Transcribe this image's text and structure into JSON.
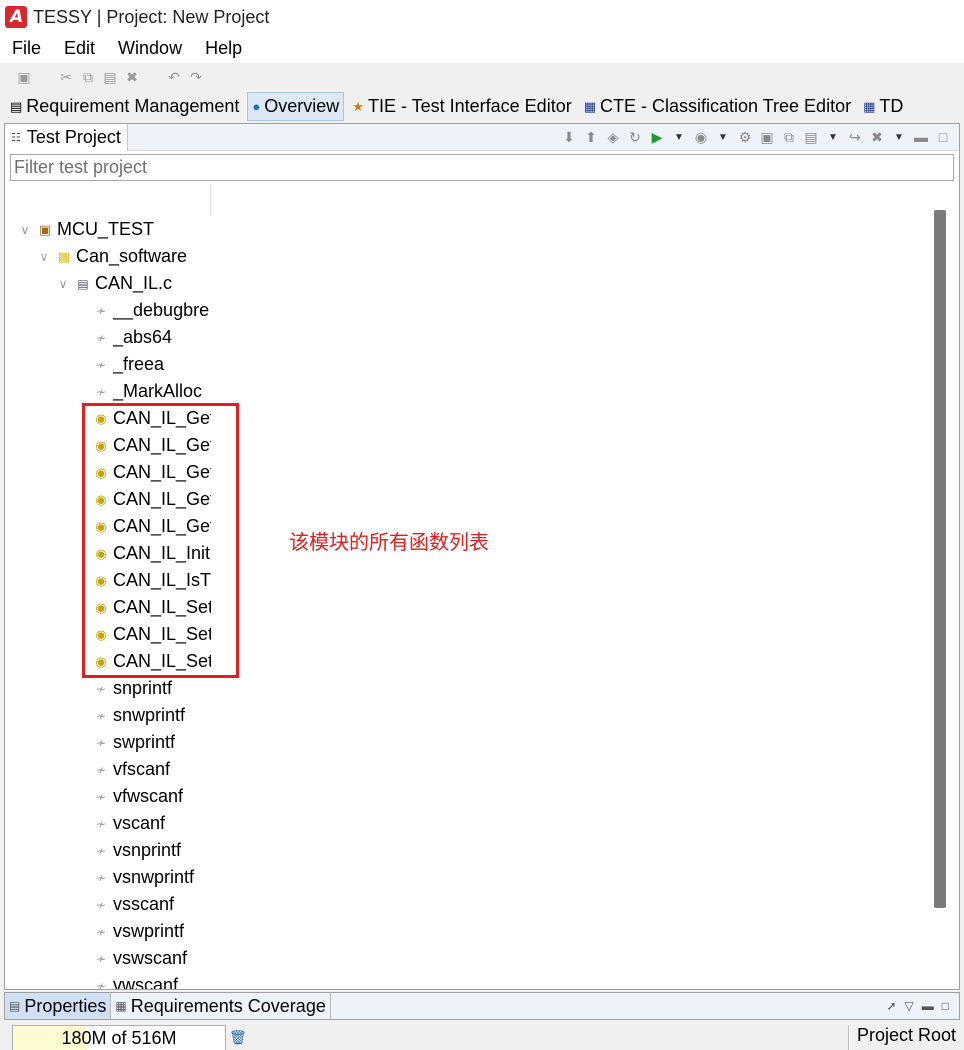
{
  "window": {
    "title": "TESSY | Project: New Project"
  },
  "menubar": {
    "items": [
      "File",
      "Edit",
      "Window",
      "Help"
    ]
  },
  "perspectives": [
    {
      "label": "Requirement Management",
      "icon": "requirements-icon",
      "active": false
    },
    {
      "label": "Overview",
      "icon": "globe-icon",
      "active": true
    },
    {
      "label": "TIE - Test Interface Editor",
      "icon": "tie-icon",
      "active": false
    },
    {
      "label": "CTE - Classification Tree Editor",
      "icon": "cte-icon",
      "active": false
    },
    {
      "label": "TD",
      "icon": "td-icon",
      "active": false
    }
  ],
  "view": {
    "title": "Test Project",
    "filter_placeholder": "Filter test project"
  },
  "tree": {
    "project": "MCU_TEST",
    "module": "Can_software",
    "file": "CAN_IL.c",
    "functions": [
      {
        "label": "__debugbre",
        "kind": "gray"
      },
      {
        "label": "_abs64",
        "kind": "gray"
      },
      {
        "label": "_freea",
        "kind": "gray"
      },
      {
        "label": "_MarkAlloc",
        "kind": "gray"
      },
      {
        "label": "CAN_IL_Get",
        "kind": "yellow"
      },
      {
        "label": "CAN_IL_Get",
        "kind": "yellow"
      },
      {
        "label": "CAN_IL_Get",
        "kind": "yellow"
      },
      {
        "label": "CAN_IL_Get",
        "kind": "yellow"
      },
      {
        "label": "CAN_IL_Get",
        "kind": "yellow"
      },
      {
        "label": "CAN_IL_Init",
        "kind": "yellow"
      },
      {
        "label": "CAN_IL_IsTx",
        "kind": "yellow"
      },
      {
        "label": "CAN_IL_Set",
        "kind": "yellow"
      },
      {
        "label": "CAN_IL_Set",
        "kind": "yellow"
      },
      {
        "label": "CAN_IL_Set",
        "kind": "yellow"
      },
      {
        "label": "snprintf",
        "kind": "gray"
      },
      {
        "label": "snwprintf",
        "kind": "gray"
      },
      {
        "label": "swprintf",
        "kind": "gray"
      },
      {
        "label": "vfscanf",
        "kind": "gray"
      },
      {
        "label": "vfwscanf",
        "kind": "gray"
      },
      {
        "label": "vscanf",
        "kind": "gray"
      },
      {
        "label": "vsnprintf",
        "kind": "gray"
      },
      {
        "label": "vsnwprintf",
        "kind": "gray"
      },
      {
        "label": "vsscanf",
        "kind": "gray"
      },
      {
        "label": "vswprintf",
        "kind": "gray"
      },
      {
        "label": "vswscanf",
        "kind": "gray"
      },
      {
        "label": "vwscanf",
        "kind": "gray"
      }
    ]
  },
  "annotation": {
    "text": "该模块的所有函数列表",
    "color": "#e02020"
  },
  "bottom_tabs": [
    {
      "label": "Properties",
      "icon": "properties-icon",
      "active": true
    },
    {
      "label": "Requirements Coverage",
      "icon": "table-icon",
      "active": false
    }
  ],
  "status": {
    "memory": "180M of 516M",
    "memory_fraction": 0.349,
    "right_text": "Project Root"
  },
  "colors": {
    "accent": "#e02020",
    "active_tab": "#cfe0f5",
    "run_green": "#1e9a2c"
  }
}
